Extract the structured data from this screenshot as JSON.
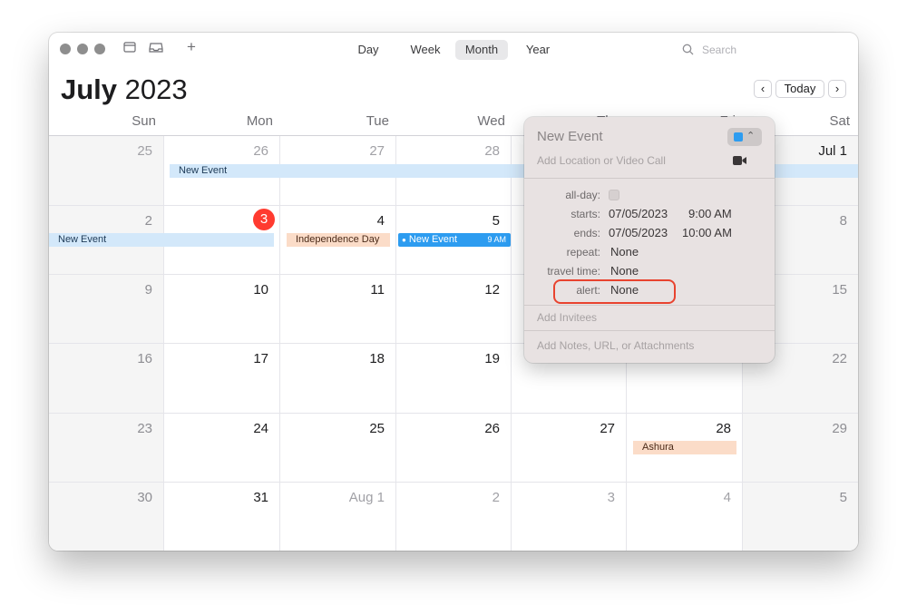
{
  "toolbar": {
    "views": [
      "Day",
      "Week",
      "Month",
      "Year"
    ],
    "active_view": "Month",
    "search_placeholder": "Search",
    "add_label": "+"
  },
  "header": {
    "month": "July",
    "year": "2023",
    "today_label": "Today",
    "prev_label": "‹",
    "next_label": "›"
  },
  "weekdays": [
    "Sun",
    "Mon",
    "Tue",
    "Wed",
    "Thu",
    "Fri",
    "Sat"
  ],
  "weeks": [
    [
      "25",
      "26",
      "27",
      "28",
      "",
      "",
      "Jul 1"
    ],
    [
      "2",
      "3",
      "4",
      "5",
      "",
      "",
      "8"
    ],
    [
      "9",
      "10",
      "11",
      "12",
      "",
      "",
      "15"
    ],
    [
      "16",
      "17",
      "18",
      "19",
      "",
      "",
      "22"
    ],
    [
      "23",
      "24",
      "25",
      "26",
      "27",
      "28",
      "29"
    ],
    [
      "30",
      "31",
      "Aug 1",
      "2",
      "3",
      "4",
      "5"
    ]
  ],
  "events": {
    "week1_new_event": "New Event",
    "week2_new_event": "New Event",
    "independence_day": "Independence Day",
    "selected_event": "New Event",
    "selected_event_time": "9 AM",
    "ashura": "Ashura"
  },
  "colors": {
    "today": "#ff3b30",
    "event_blue": "#d3e8fa",
    "event_selected": "#2d9cf0",
    "holiday": "#fbdcc8",
    "alert_highlight": "#e8432f"
  },
  "popover": {
    "title": "New Event",
    "location_placeholder": "Add Location or Video Call",
    "allday_label": "all-day:",
    "starts_label": "starts:",
    "starts_date": "07/05/2023",
    "starts_time": "9:00 AM",
    "ends_label": "ends:",
    "ends_date": "07/05/2023",
    "ends_time": "10:00 AM",
    "repeat_label": "repeat:",
    "repeat_value": "None",
    "travel_label": "travel time:",
    "travel_value": "None",
    "alert_label": "alert:",
    "alert_value": "None",
    "invitees": "Add Invitees",
    "notes": "Add Notes, URL, or Attachments"
  }
}
